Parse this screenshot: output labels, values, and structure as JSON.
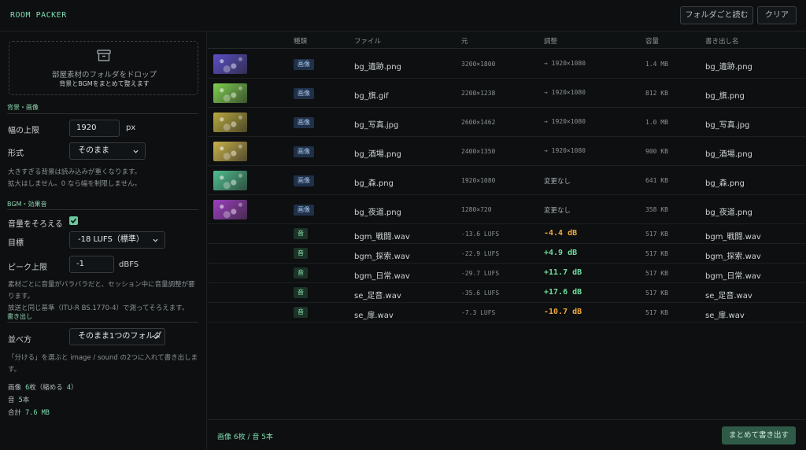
{
  "app": {
    "title": "ROOM PACKER"
  },
  "header": {
    "load_folder_label": "フォルダごと読む",
    "clear_label": "クリア"
  },
  "dropzone": {
    "icon": "box-icon",
    "main_text": "部屋素材のフォルダをドロップ",
    "sub_text": "背景とBGMをまとめて整えます"
  },
  "background": {
    "section_title": "背景・画像",
    "max_width_label": "幅の上限",
    "max_width_value": "1920",
    "max_width_unit": "px",
    "format_label": "形式",
    "format_value": "そのまま",
    "note_line1": "大きすぎる背景は読み込みが重くなります。",
    "note_line2": "拡大はしません。0 なら幅を制限しません。"
  },
  "audio": {
    "section_title": "BGM・効果音",
    "normalize_label": "音量をそろえる",
    "normalize_checked": true,
    "target_label": "目標",
    "target_value": "-18 LUFS（標準）",
    "peak_label": "ピーク上限",
    "peak_value": "-1",
    "peak_unit": "dBFS",
    "note_line1": "素材ごとに音量がバラバラだと、セッション中に音量調整が要ります。",
    "note_line2": "放送と同じ基準（ITU-R BS.1770-4）で測ってそろえます。"
  },
  "export": {
    "section_title": "書き出し",
    "order_label": "並べ方",
    "order_value": "そのまま1つのフォルダ",
    "note": "「分ける」を選ぶと image / sound の2つに入れて書き出します。"
  },
  "summary": {
    "images_prefix": "画像 ",
    "images_count": "6",
    "images_unit": "枚（縮める ",
    "shrink_count": "4",
    "images_suffix": "）",
    "sounds_prefix": "音 ",
    "sounds_count": "5",
    "sounds_unit": "本",
    "total_prefix": "合計 ",
    "total_value": "7.6 MB"
  },
  "table": {
    "columns": {
      "kind": "種類",
      "file": "ファイル",
      "original": "元",
      "adjust": "調整",
      "size": "容量",
      "output": "書き出し名"
    },
    "image_rows": [
      {
        "kind": "画像",
        "file": "bg_遺跡.png",
        "original": "3200×1800",
        "adjust": "→ 1920×1080",
        "size": "1.4 MB",
        "output": "bg_遺跡.png",
        "thumb_color": "#5a4fc7"
      },
      {
        "kind": "画像",
        "file": "bg_旗.gif",
        "original": "2200×1238",
        "adjust": "→ 1920×1080",
        "size": "812 KB",
        "output": "bg_旗.png",
        "thumb_color": "#7fcf4f"
      },
      {
        "kind": "画像",
        "file": "bg_写真.jpg",
        "original": "2600×1462",
        "adjust": "→ 1920×1080",
        "size": "1.0 MB",
        "output": "bg_写真.jpg",
        "thumb_color": "#b8a83e"
      },
      {
        "kind": "画像",
        "file": "bg_酒場.png",
        "original": "2400×1350",
        "adjust": "→ 1920×1080",
        "size": "900 KB",
        "output": "bg_酒場.png",
        "thumb_color": "#c9b14a"
      },
      {
        "kind": "画像",
        "file": "bg_森.png",
        "original": "1920×1080",
        "adjust": "変更なし",
        "size": "641 KB",
        "output": "bg_森.png",
        "thumb_color": "#4fbf8e"
      },
      {
        "kind": "画像",
        "file": "bg_夜道.png",
        "original": "1280×720",
        "adjust": "変更なし",
        "size": "358 KB",
        "output": "bg_夜道.png",
        "thumb_color": "#9d3fc0"
      }
    ],
    "sound_rows": [
      {
        "kind": "音",
        "file": "bgm_戦闘.wav",
        "original": "-13.6 LUFS",
        "adjust": "-4.4 dB",
        "size": "517 KB",
        "output": "bgm_戦闘.wav",
        "gain": "neg"
      },
      {
        "kind": "音",
        "file": "bgm_探索.wav",
        "original": "-22.9 LUFS",
        "adjust": "+4.9 dB",
        "size": "517 KB",
        "output": "bgm_探索.wav",
        "gain": "pos"
      },
      {
        "kind": "音",
        "file": "bgm_日常.wav",
        "original": "-29.7 LUFS",
        "adjust": "+11.7 dB",
        "size": "517 KB",
        "output": "bgm_日常.wav",
        "gain": "pos"
      },
      {
        "kind": "音",
        "file": "se_足音.wav",
        "original": "-35.6 LUFS",
        "adjust": "+17.6 dB",
        "size": "517 KB",
        "output": "se_足音.wav",
        "gain": "pos"
      },
      {
        "kind": "音",
        "file": "se_扉.wav",
        "original": "-7.3 LUFS",
        "adjust": "-10.7 dB",
        "size": "517 KB",
        "output": "se_扉.wav",
        "gain": "neg"
      }
    ]
  },
  "footer": {
    "count_text": "画像 6枚 / 音 5本",
    "export_label": "まとめて書き出す"
  },
  "colors": {
    "accent": "#7fdcb0",
    "gain_positive": "#6fdc9e",
    "gain_negative": "#f0a83e",
    "export_button": "#2f5a48"
  }
}
